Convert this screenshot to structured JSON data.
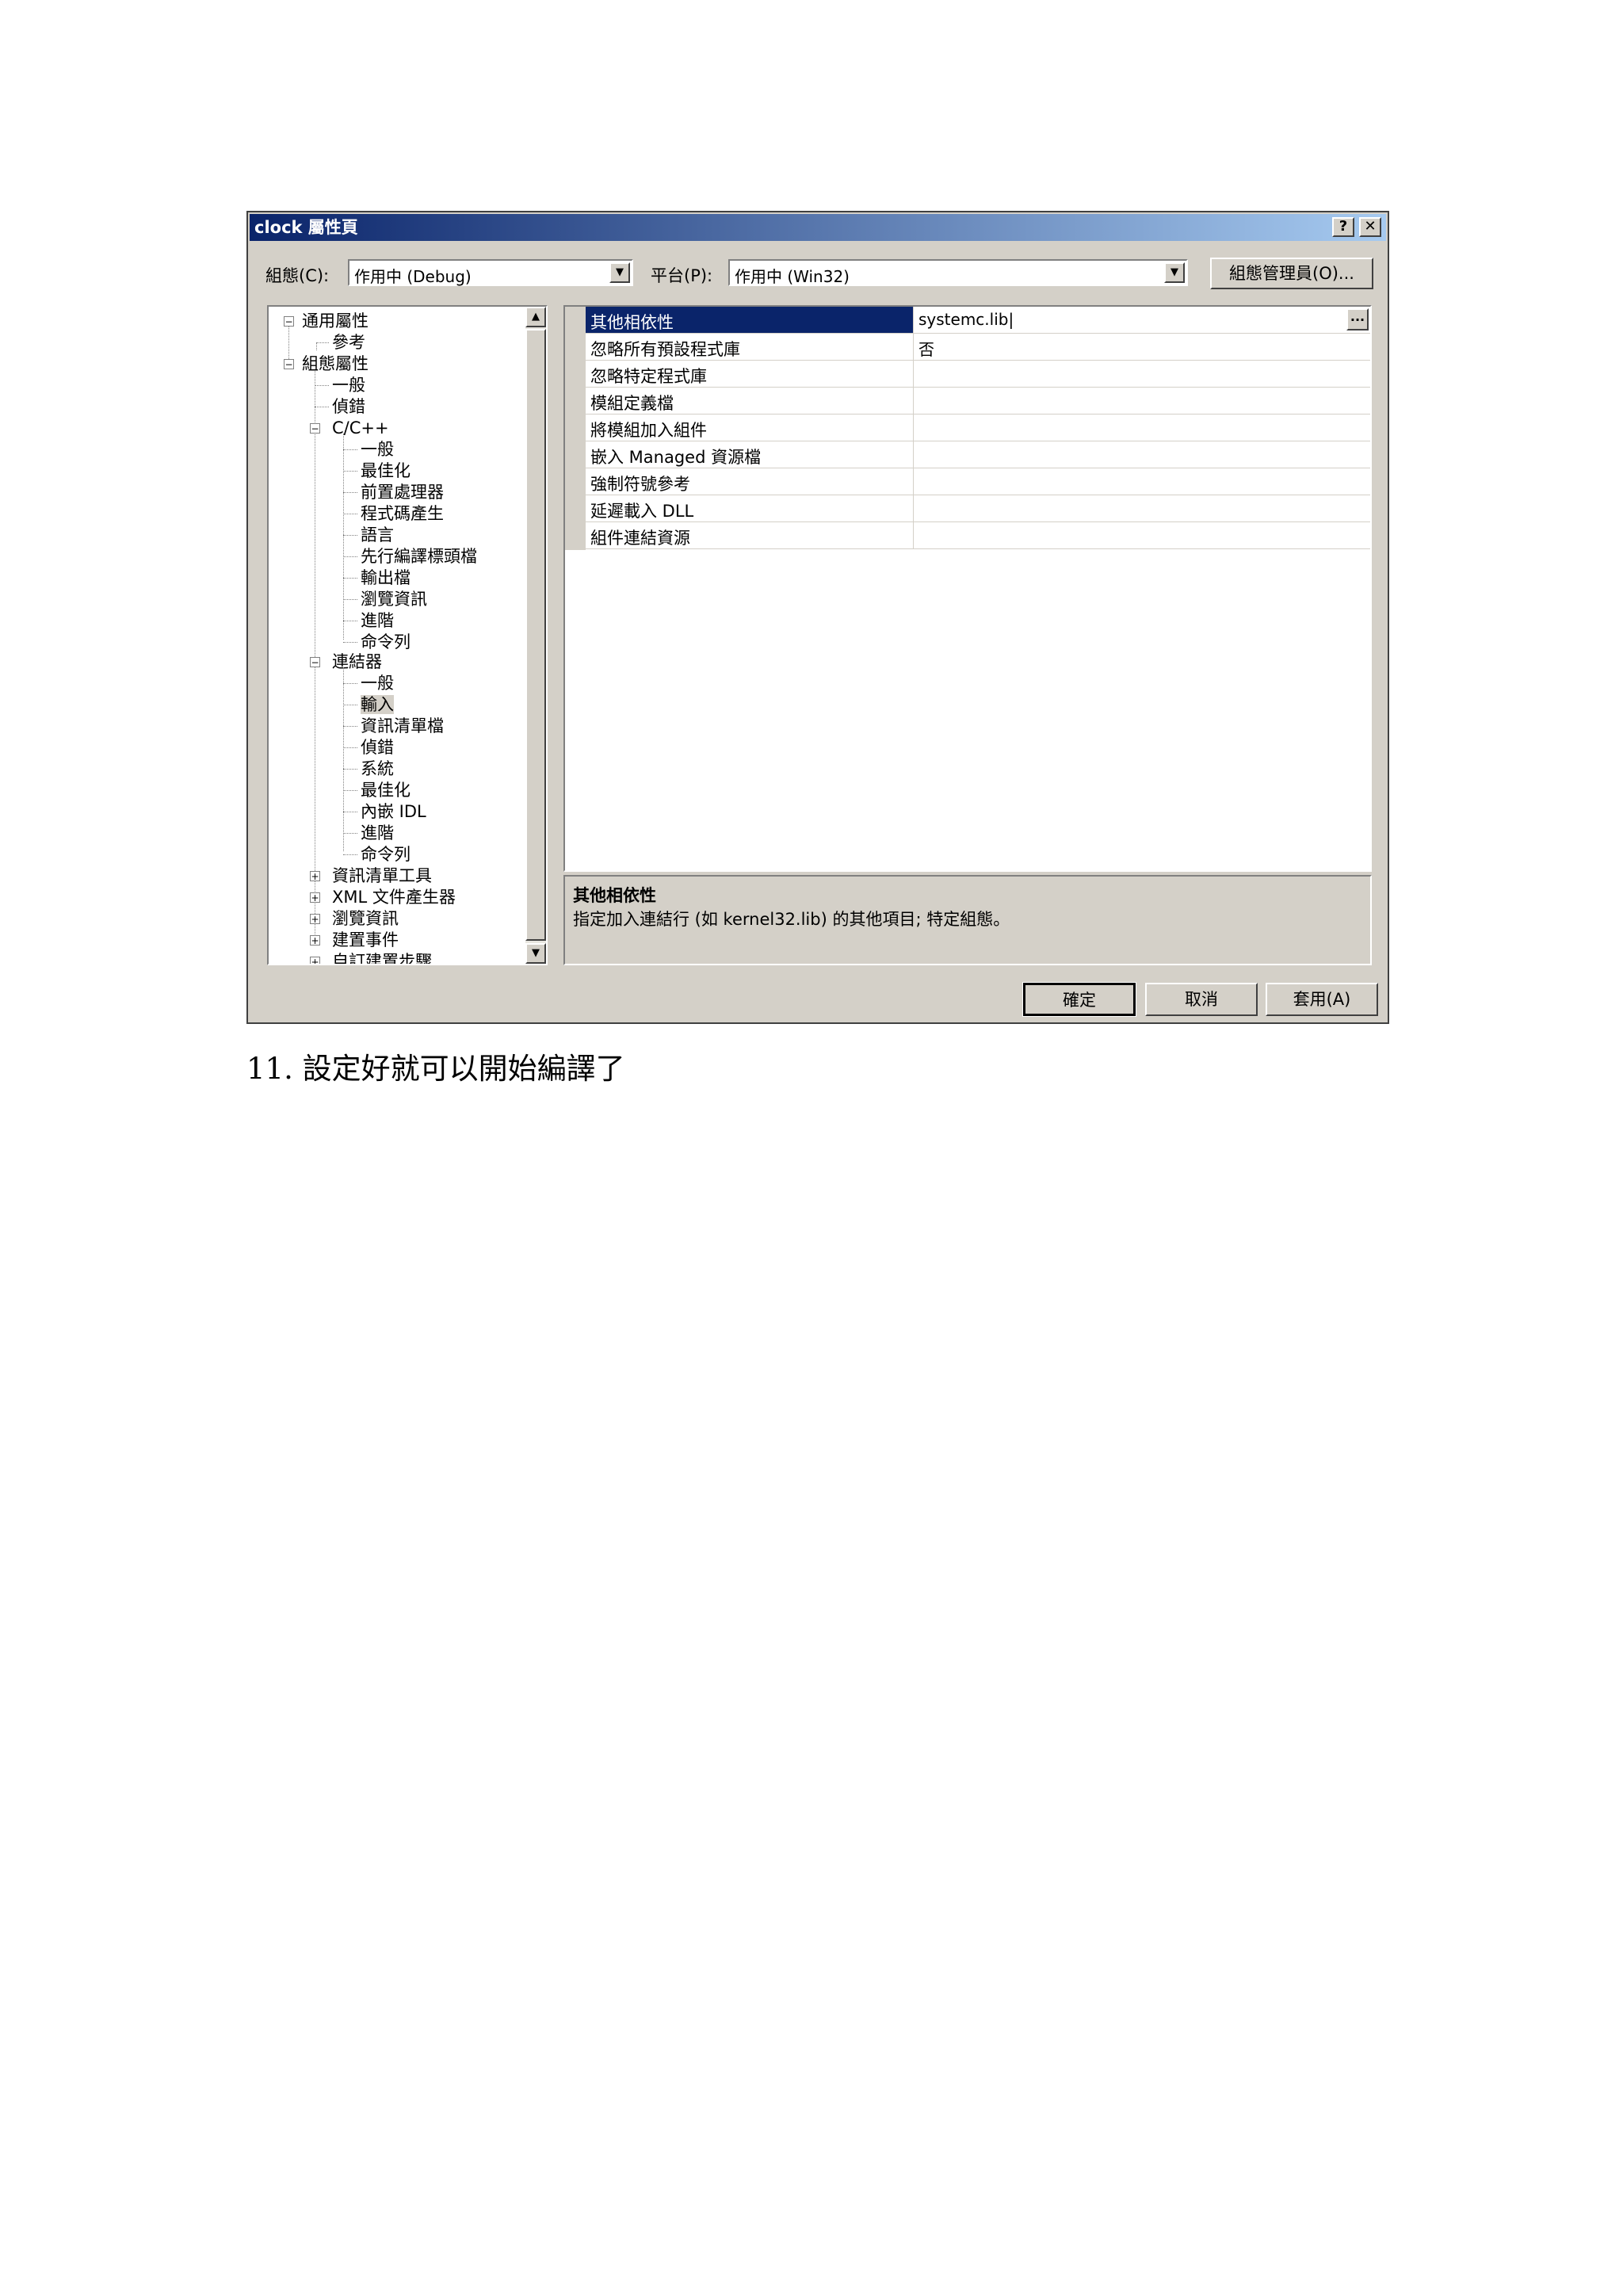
{
  "window": {
    "title": "clock 屬性頁",
    "help_label": "?",
    "close_label": "✕"
  },
  "top": {
    "config_label": "組態(C):",
    "config_value": "作用中 (Debug)",
    "platform_label": "平台(P):",
    "platform_value": "作用中 (Win32)",
    "config_manager_label": "組態管理員(O)..."
  },
  "tree": {
    "common_props": "通用屬性",
    "reference": "參考",
    "config_props": "組態屬性",
    "general": "一般",
    "debugging": "偵錯",
    "cpp": "C/C++",
    "cpp_items": [
      "一般",
      "最佳化",
      "前置處理器",
      "程式碼產生",
      "語言",
      "先行編譯標頭檔",
      "輸出檔",
      "瀏覽資訊",
      "進階",
      "命令列"
    ],
    "linker": "連結器",
    "linker_items": [
      "一般",
      "輸入",
      "資訊清單檔",
      "偵錯",
      "系統",
      "最佳化",
      "內嵌 IDL",
      "進階",
      "命令列"
    ],
    "bottom_items": [
      "資訊清單工具",
      "XML 文件產生器",
      "瀏覽資訊",
      "建置事件",
      "自訂建置步驟"
    ]
  },
  "grid": {
    "rows": [
      {
        "name": "其他相依性",
        "value": "systemc.lib|"
      },
      {
        "name": "忽略所有預設程式庫",
        "value": "否"
      },
      {
        "name": "忽略特定程式庫",
        "value": ""
      },
      {
        "name": "模組定義檔",
        "value": ""
      },
      {
        "name": "將模組加入組件",
        "value": ""
      },
      {
        "name": "嵌入 Managed 資源檔",
        "value": ""
      },
      {
        "name": "強制符號參考",
        "value": ""
      },
      {
        "name": "延遲載入 DLL",
        "value": ""
      },
      {
        "name": "組件連結資源",
        "value": ""
      }
    ],
    "ellipsis_label": "..."
  },
  "description": {
    "title": "其他相依性",
    "text": "指定加入連結行 (如 kernel32.lib) 的其他項目; 特定組態。"
  },
  "buttons": {
    "ok": "確定",
    "cancel": "取消",
    "apply": "套用(A)"
  },
  "caption": "11.  設定好就可以開始編譯了"
}
